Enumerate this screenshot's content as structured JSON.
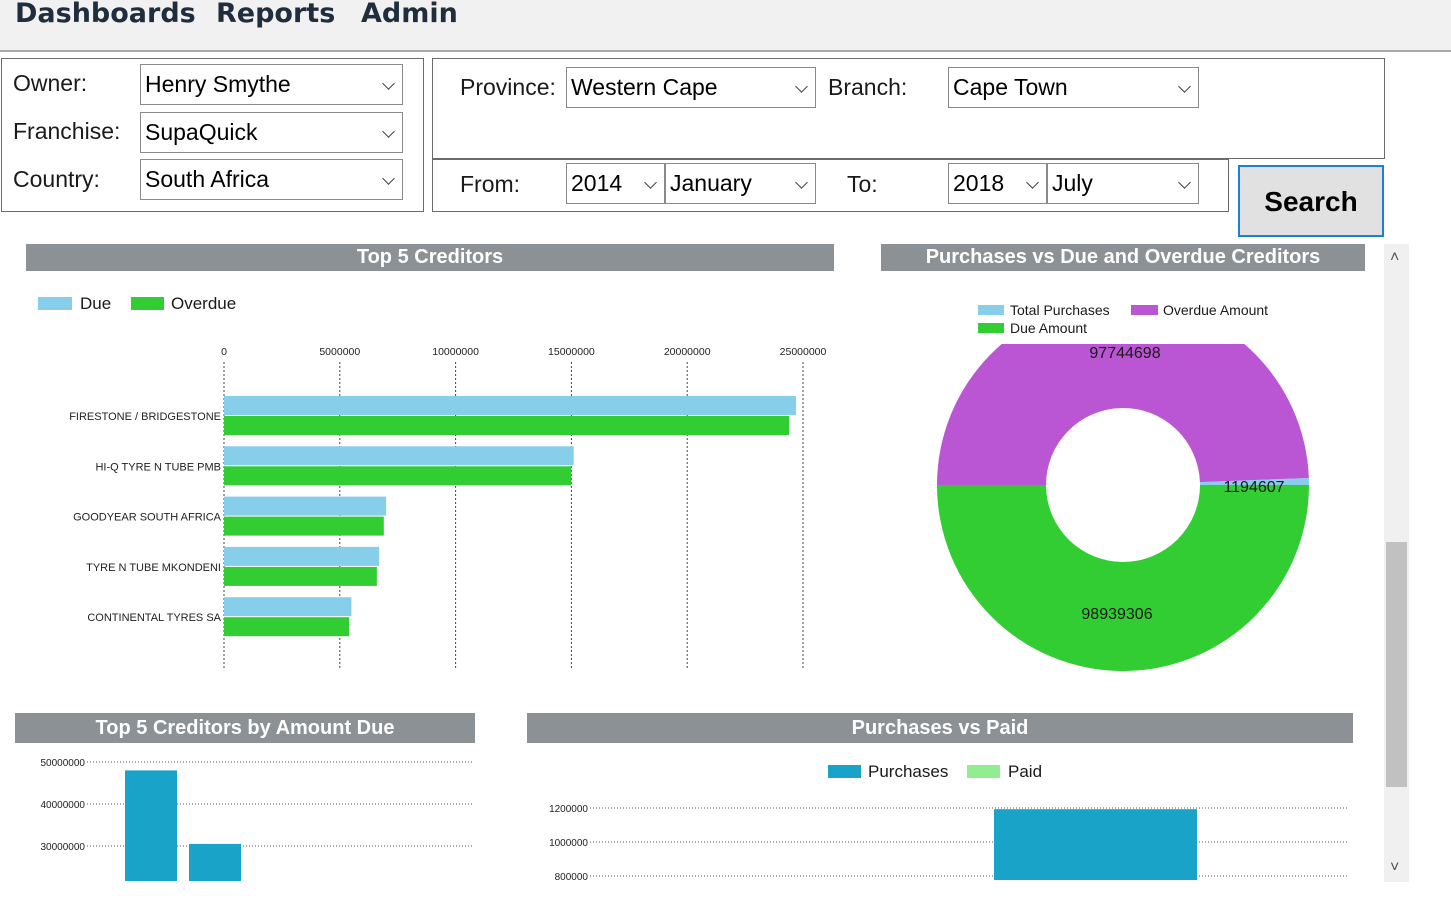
{
  "menu": [
    "Dashboards",
    "Reports",
    "Admin"
  ],
  "filters": {
    "owner_label": "Owner:",
    "owner": "Henry Smythe",
    "franchise_label": "Franchise:",
    "franchise": "SupaQuick",
    "country_label": "Country:",
    "country": "South Africa",
    "province_label": "Province:",
    "province": "Western Cape",
    "branch_label": "Branch:",
    "branch": "Cape Town",
    "from_label": "From:",
    "from_year": "2014",
    "from_month": "January",
    "to_label": "To:",
    "to_year": "2018",
    "to_month": "July",
    "search_label": "Search"
  },
  "colors": {
    "due": "#87ceeb",
    "overdue": "#32cd32",
    "total_purchases": "#87ceeb",
    "overdue_amount": "#ba55d3",
    "due_amount": "#32cd32",
    "purchases": "#1aa3c9",
    "paid": "#90ee90",
    "header": "#8c9196"
  },
  "chart_data": [
    {
      "type": "bar",
      "orientation": "horizontal",
      "title": "Top 5 Creditors",
      "categories": [
        "FIRESTONE / BRIDGESTONE",
        "HI-Q TYRE N TUBE PMB",
        "GOODYEAR SOUTH AFRICA",
        "TYRE N TUBE MKONDENI",
        "CONTINENTAL TYRES SA"
      ],
      "series": [
        {
          "name": "Due",
          "values": [
            24700000,
            15100000,
            7000000,
            6700000,
            5500000
          ]
        },
        {
          "name": "Overdue",
          "values": [
            24400000,
            15000000,
            6900000,
            6600000,
            5400000
          ]
        }
      ],
      "xticks": [
        "0",
        "5000000",
        "10000000",
        "15000000",
        "20000000",
        "25000000"
      ],
      "xlim": [
        0,
        25000000
      ],
      "legend": "top-left",
      "grid": true
    },
    {
      "type": "pie",
      "style": "doughnut",
      "title": "Purchases vs Due and Overdue Creditors",
      "slices": [
        {
          "name": "Total Purchases",
          "value": 1194607,
          "label": "1194607"
        },
        {
          "name": "Overdue Amount",
          "value": 97744698,
          "label": "97744698"
        },
        {
          "name": "Due Amount",
          "value": 98939306,
          "label": "98939306"
        }
      ],
      "legend": "top"
    },
    {
      "type": "bar",
      "title": "Top 5 Creditors by Amount Due",
      "values": [
        48000000,
        30500000
      ],
      "yticks": [
        "50000000",
        "40000000",
        "30000000"
      ],
      "ylim": [
        27000000,
        52000000
      ],
      "grid": true
    },
    {
      "type": "bar",
      "title": "Purchases vs Paid",
      "series": [
        {
          "name": "Purchases",
          "values": [
            1193000
          ]
        },
        {
          "name": "Paid",
          "values": []
        }
      ],
      "yticks": [
        "1200000",
        "1000000",
        "800000"
      ],
      "ylim": [
        790000,
        1290000
      ],
      "legend": "top",
      "grid": true
    }
  ]
}
